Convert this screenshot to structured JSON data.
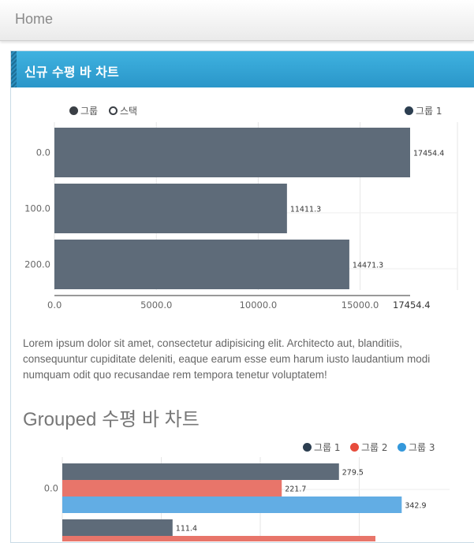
{
  "topbar": {
    "home_label": "Home"
  },
  "panel": {
    "title": "신규 수평 바 차트"
  },
  "chart1_legend": {
    "grouped": "그룹",
    "stacked": "스택"
  },
  "lorem": "Lorem ipsum dolor sit amet, consectetur adipisicing elit. Architecto aut, blanditiis, consequuntur cupiditate deleniti, eaque earum esse eum harum iusto laudantium modi numquam odit quo recusandae rem tempora tenetur voluptatem!",
  "section2_title": "Grouped 수평 바 차트",
  "colors": {
    "series1": "#5e6b79",
    "series2": "#e8756a",
    "series3": "#62ade4",
    "accent": "#2a96c9"
  },
  "chart_data": [
    {
      "type": "bar",
      "orientation": "horizontal",
      "categories": [
        "0.0",
        "100.0",
        "200.0"
      ],
      "series": [
        {
          "name": "그룹 1",
          "values": [
            17454.4,
            11411.3,
            14471.3
          ]
        }
      ],
      "xticks": [
        "0.0",
        "5000.0",
        "10000.0",
        "15000.0",
        "17454.4"
      ],
      "xlim": [
        0,
        17454.4
      ],
      "value_labels": [
        "17454.4",
        "11411.3",
        "14471.3"
      ],
      "legend": "top-right",
      "grid": true
    },
    {
      "type": "bar",
      "orientation": "horizontal",
      "categories": [
        "0.0",
        ""
      ],
      "series": [
        {
          "name": "그룹 1",
          "values": [
            279.5,
            111.4
          ]
        },
        {
          "name": "그룹 2",
          "values": [
            221.7,
            null
          ]
        },
        {
          "name": "그룹 3",
          "values": [
            342.9,
            null
          ]
        }
      ],
      "value_labels": [
        [
          "279.5",
          "111.4"
        ],
        [
          "221.7",
          ""
        ],
        [
          "342.9",
          ""
        ]
      ],
      "legend": "top-right",
      "grid": true
    }
  ]
}
